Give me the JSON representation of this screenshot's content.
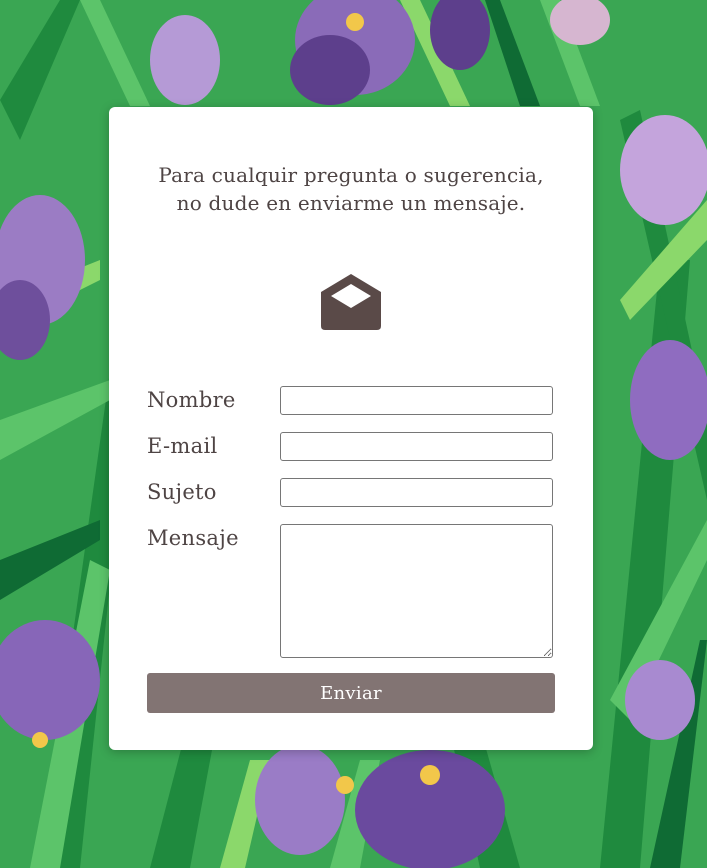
{
  "contact": {
    "intro_line1": "Para cualquir pregunta o sugerencia,",
    "intro_line2": "no dude en enviarme un mensaje.",
    "icon": "envelope-open-icon",
    "fields": {
      "name_label": "Nombre",
      "name_value": "",
      "email_label": "E-mail",
      "email_value": "",
      "subject_label": "Sujeto",
      "subject_value": "",
      "message_label": "Mensaje",
      "message_value": ""
    },
    "submit_label": "Enviar"
  },
  "colors": {
    "text": "#4e4444",
    "button": "#827473",
    "icon": "#5a4a48",
    "card": "#ffffff"
  }
}
